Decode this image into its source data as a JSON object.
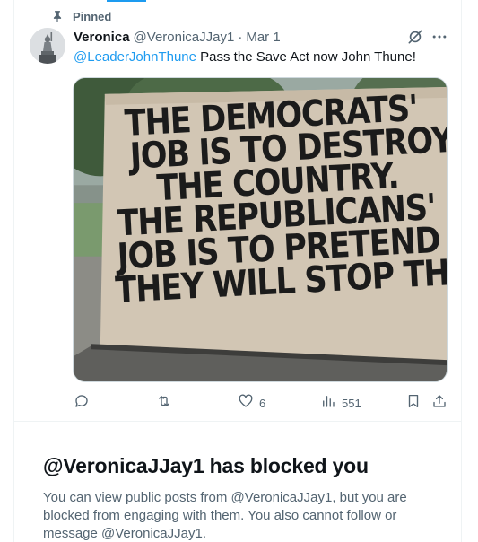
{
  "pinned": {
    "label": "Pinned",
    "icon": "pin-icon"
  },
  "tweet": {
    "display_name": "Veronica",
    "handle": "@VeronicaJJay1",
    "separator": "·",
    "date": "Mar 1",
    "mention": "@LeaderJohnThune",
    "text": " Pass the Save Act now John Thune!",
    "media": {
      "sign_lines": [
        "THE DEMOCRATS'",
        "JOB IS TO DESTROY",
        "THE COUNTRY.",
        "THE REPUBLICANS'",
        "JOB IS TO PRETEND",
        "THEY WILL STOP THEM"
      ]
    },
    "actions": {
      "reply_count": "",
      "retweet_count": "",
      "like_count": "6",
      "views_count": "551"
    }
  },
  "blocked": {
    "title": "@VeronicaJJay1 has blocked you",
    "description": "You can view public posts from @VeronicaJJay1, but you are blocked from engaging with them. You also cannot follow or message @VeronicaJJay1."
  },
  "colors": {
    "accent": "#1d9bf0",
    "text_primary": "#0f1419",
    "text_secondary": "#536471",
    "border": "#eff3f4"
  }
}
